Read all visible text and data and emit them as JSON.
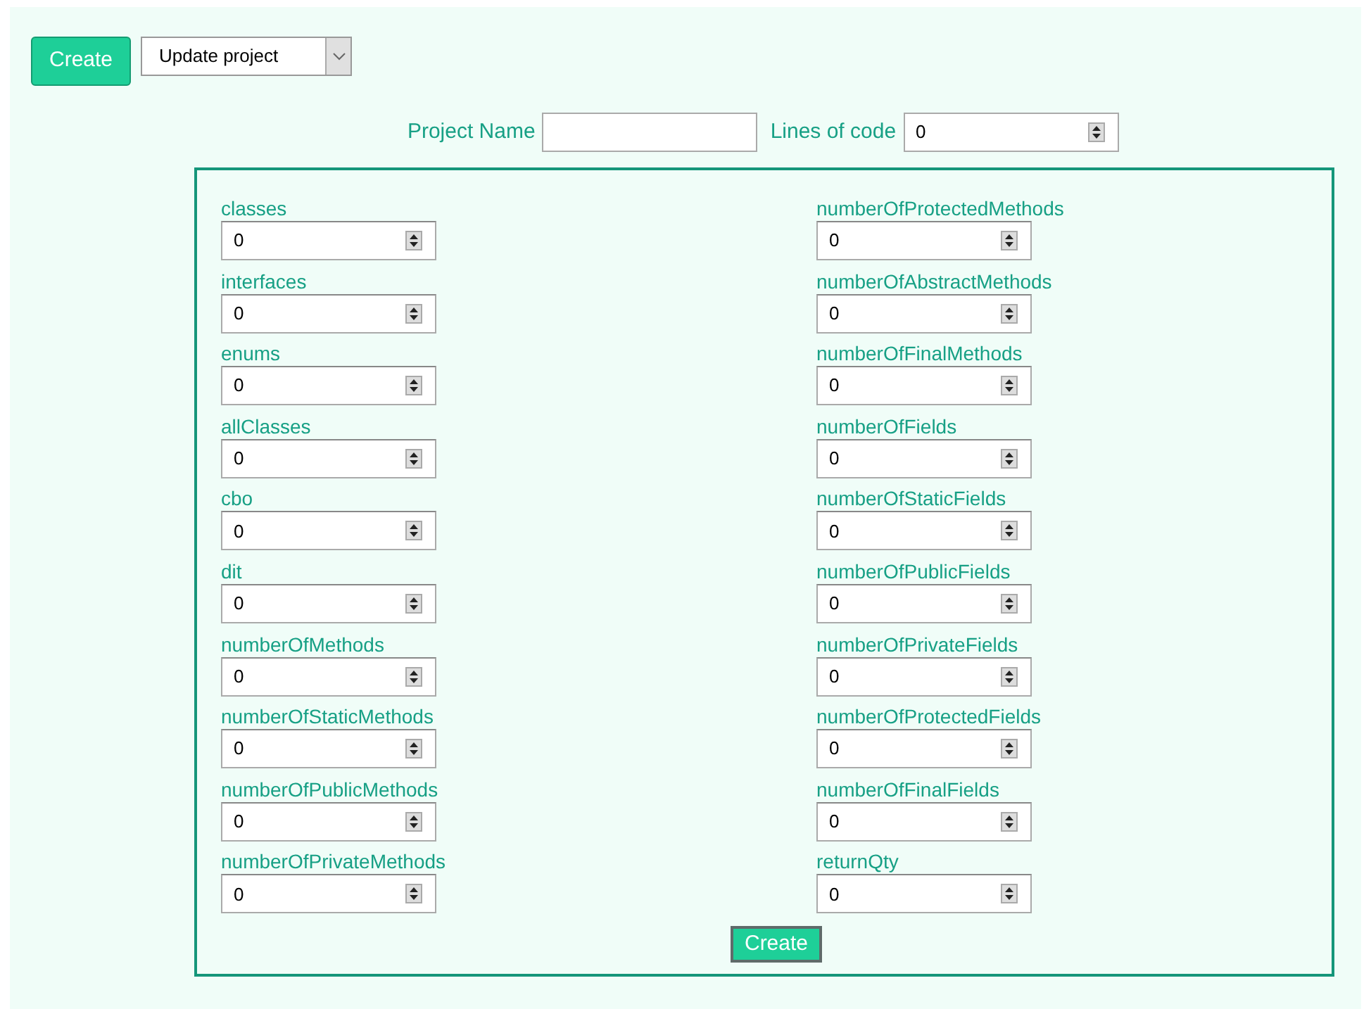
{
  "toolbar": {
    "create_button": "Create",
    "mode_select": {
      "value": "Update project"
    }
  },
  "project": {
    "name_label": "Project Name",
    "loc_label": "Lines of code",
    "loc_value": "0"
  },
  "metrics_left": [
    {
      "label": "classes",
      "value": "0"
    },
    {
      "label": "interfaces",
      "value": "0"
    },
    {
      "label": "enums",
      "value": "0"
    },
    {
      "label": "allClasses",
      "value": "0"
    },
    {
      "label": "cbo",
      "value": "0"
    },
    {
      "label": "dit",
      "value": "0"
    },
    {
      "label": "numberOfMethods",
      "value": "0"
    },
    {
      "label": "numberOfStaticMethods",
      "value": "0"
    },
    {
      "label": "numberOfPublicMethods",
      "value": "0"
    },
    {
      "label": "numberOfPrivateMethods",
      "value": "0"
    }
  ],
  "metrics_right": [
    {
      "label": "numberOfProtectedMethods",
      "value": "0"
    },
    {
      "label": "numberOfAbstractMethods",
      "value": "0"
    },
    {
      "label": "numberOfFinalMethods",
      "value": "0"
    },
    {
      "label": "numberOfFields",
      "value": "0"
    },
    {
      "label": "numberOfStaticFields",
      "value": "0"
    },
    {
      "label": "numberOfPublicFields",
      "value": "0"
    },
    {
      "label": "numberOfPrivateFields",
      "value": "0"
    },
    {
      "label": "numberOfProtectedFields",
      "value": "0"
    },
    {
      "label": "numberOfFinalFields",
      "value": "0"
    },
    {
      "label": "returnQty",
      "value": "0"
    }
  ],
  "submit_button": "Create"
}
